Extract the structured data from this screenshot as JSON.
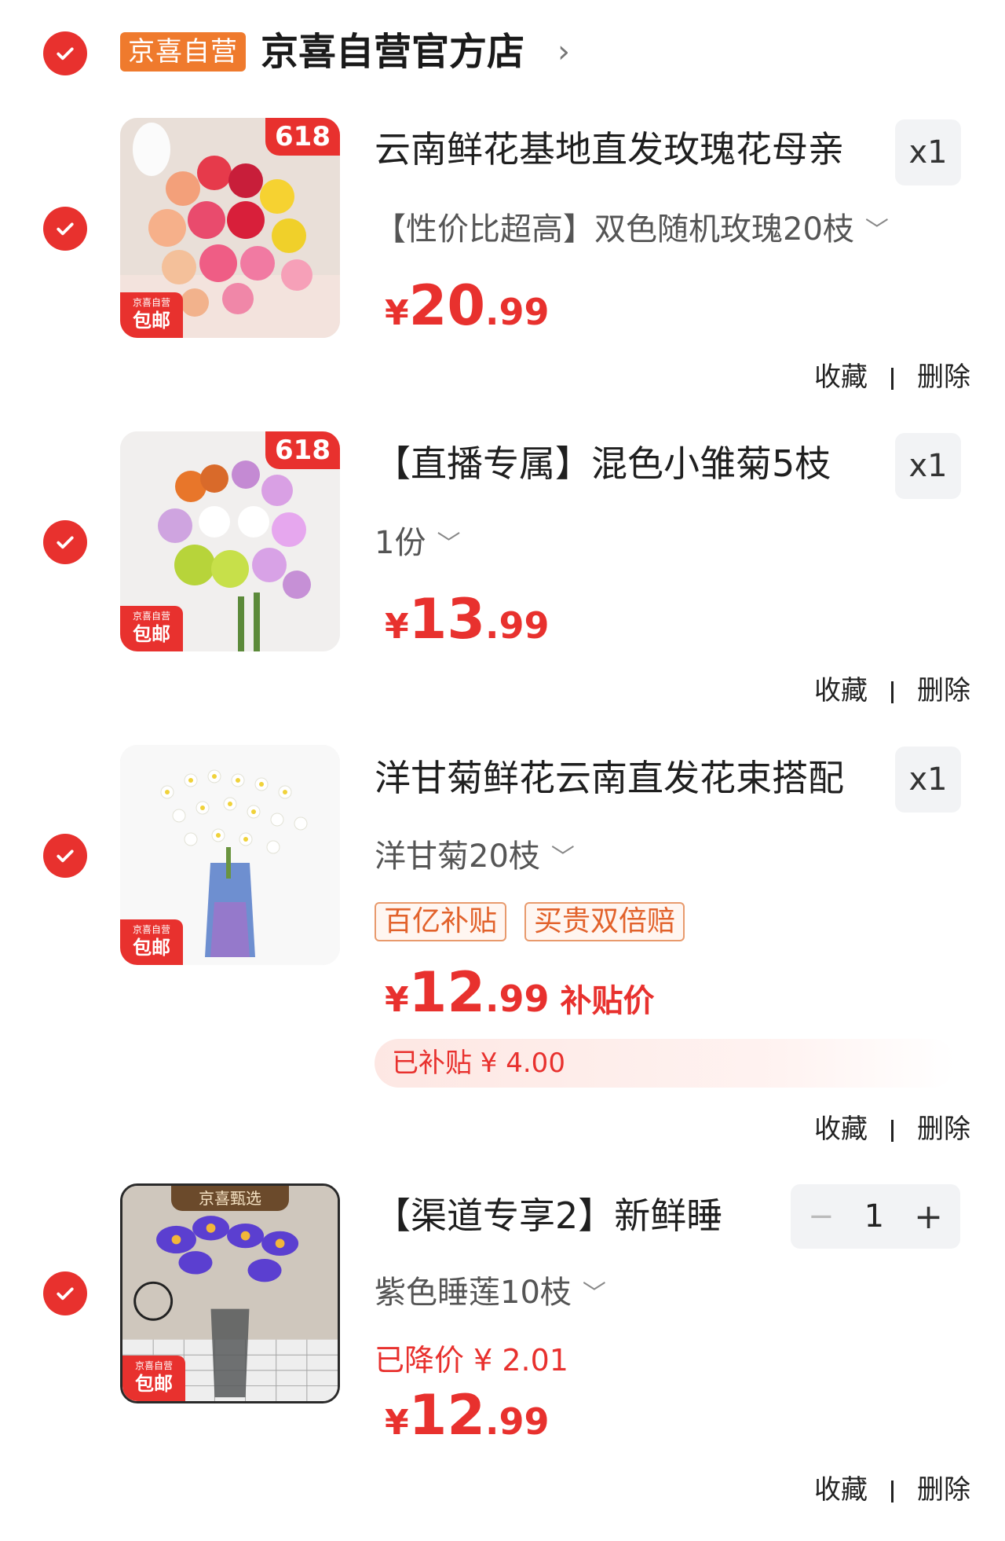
{
  "store": {
    "tag": "京喜自营",
    "name": "京喜自营官方店"
  },
  "items": [
    {
      "title": "云南鲜花基地直发玫瑰花母亲",
      "qty": "x1",
      "spec": "【性价比超高】双色随机玫瑰20枝",
      "price": {
        "yen": "¥",
        "int": "20",
        "dec": ".99"
      },
      "tag_618": "618",
      "tag_free_small": "京喜自营",
      "tag_free": "包邮",
      "actions": {
        "fav": "收藏",
        "del": "删除"
      }
    },
    {
      "title": "【直播专属】混色小雏菊5枝",
      "qty": "x1",
      "spec": "1份",
      "price": {
        "yen": "¥",
        "int": "13",
        "dec": ".99"
      },
      "tag_618": "618",
      "tag_free_small": "京喜自营",
      "tag_free": "包邮",
      "actions": {
        "fav": "收藏",
        "del": "删除"
      }
    },
    {
      "title": "洋甘菊鲜花云南直发花束搭配",
      "qty": "x1",
      "spec": "洋甘菊20枝",
      "badges": [
        "百亿补贴",
        "买贵双倍赔"
      ],
      "price": {
        "yen": "¥",
        "int": "12",
        "dec": ".99",
        "suffix": "补贴价"
      },
      "subsidy": "已补贴 ¥ 4.00",
      "tag_free_small": "京喜自营",
      "tag_free": "包邮",
      "actions": {
        "fav": "收藏",
        "del": "删除"
      }
    },
    {
      "title": "【渠道专享2】新鲜睡",
      "stepper": {
        "minus": "−",
        "value": "1",
        "plus": "+"
      },
      "spec": "紫色睡莲10枝",
      "drop_note": "已降价 ¥ 2.01",
      "price": {
        "yen": "¥",
        "int": "12",
        "dec": ".99"
      },
      "tag_top": "京喜甄选",
      "tag_free_small": "京喜自营",
      "tag_free": "包邮",
      "actions": {
        "fav": "收藏",
        "del": "删除"
      }
    }
  ],
  "icons": {
    "check": "check-circle-icon",
    "caret": "chevron-down-icon",
    "store_arrow": "chevron-right-icon"
  },
  "colors": {
    "accent": "#e8312e",
    "store_tag": "#ef7a2d",
    "subsidy_text": "#e2622b"
  }
}
